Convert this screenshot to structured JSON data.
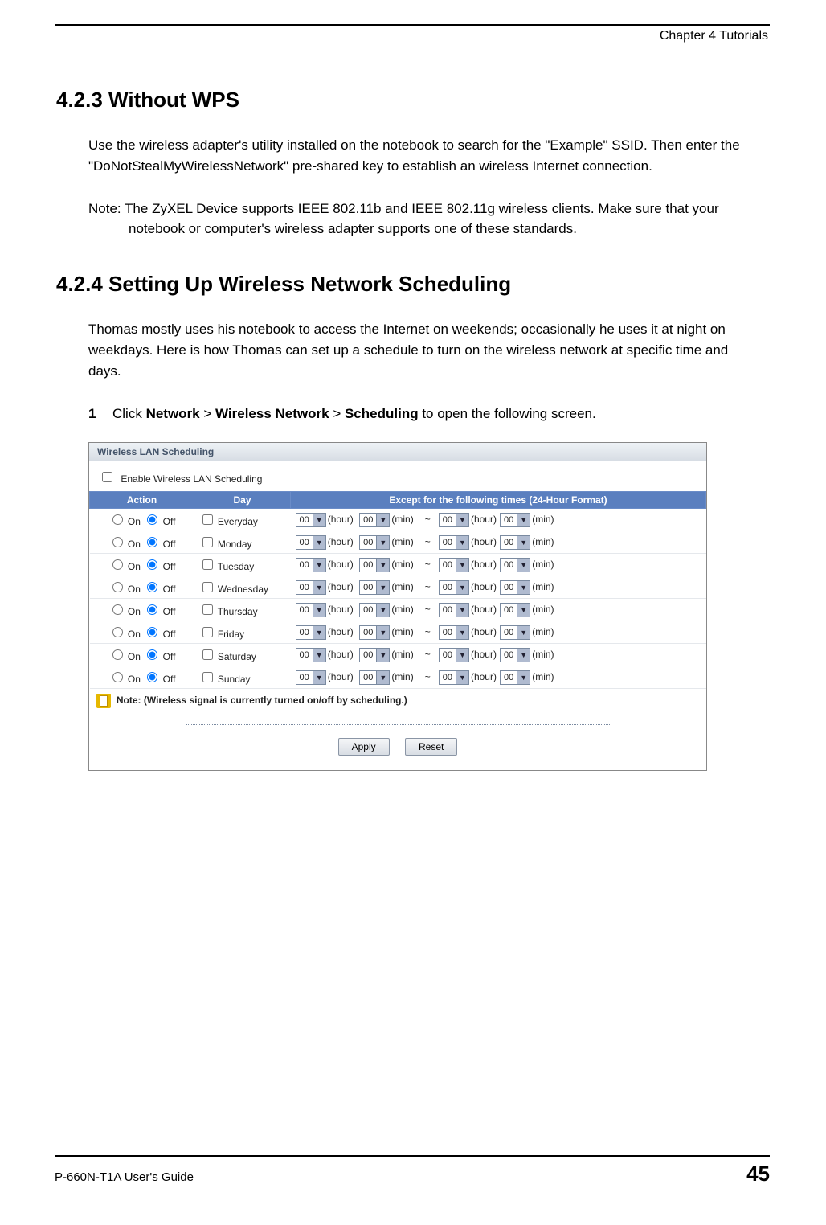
{
  "header": {
    "chapter": "Chapter 4 Tutorials"
  },
  "section423": {
    "heading": "4.2.3  Without WPS",
    "body": "Use the wireless adapter's utility installed on the notebook to search for the \"Example\" SSID. Then enter the \"DoNotStealMyWirelessNetwork\" pre-shared key to establish an wireless Internet connection.",
    "note": "Note: The ZyXEL Device supports IEEE 802.11b and IEEE 802.11g wireless clients. Make sure that your notebook or computer's wireless adapter supports one of these standards."
  },
  "section424": {
    "heading": "4.2.4  Setting Up Wireless Network Scheduling",
    "body": "Thomas mostly uses his notebook to access the Internet on weekends; occasionally he uses it at night on weekdays. Here is how Thomas can set up a schedule to turn on the wireless network at specific time and days.",
    "step1_num": "1",
    "step1_pre": "Click ",
    "step1_b1": "Network",
    "step1_gt1": " > ",
    "step1_b2": "Wireless Network",
    "step1_gt2": " > ",
    "step1_b3": "Scheduling",
    "step1_post": " to open the following screen."
  },
  "screenshot": {
    "title": "Wireless LAN Scheduling",
    "enable_label": "Enable Wireless LAN Scheduling",
    "headers": {
      "action": "Action",
      "day": "Day",
      "times": "Except for the following times   (24-Hour Format)"
    },
    "on_label": "On",
    "off_label": "Off",
    "hour_unit": "(hour)",
    "min_unit": "(min)",
    "tilde": "~",
    "value": "00",
    "rows": [
      {
        "day": "Everyday"
      },
      {
        "day": "Monday"
      },
      {
        "day": "Tuesday"
      },
      {
        "day": "Wednesday"
      },
      {
        "day": "Thursday"
      },
      {
        "day": "Friday"
      },
      {
        "day": "Saturday"
      },
      {
        "day": "Sunday"
      }
    ],
    "note_label": "Note:",
    "note_text": "(Wireless signal is currently turned on/off by scheduling.)",
    "apply_label": "Apply",
    "reset_label": "Reset"
  },
  "footer": {
    "guide": "P-660N-T1A User's Guide",
    "page": "45"
  }
}
